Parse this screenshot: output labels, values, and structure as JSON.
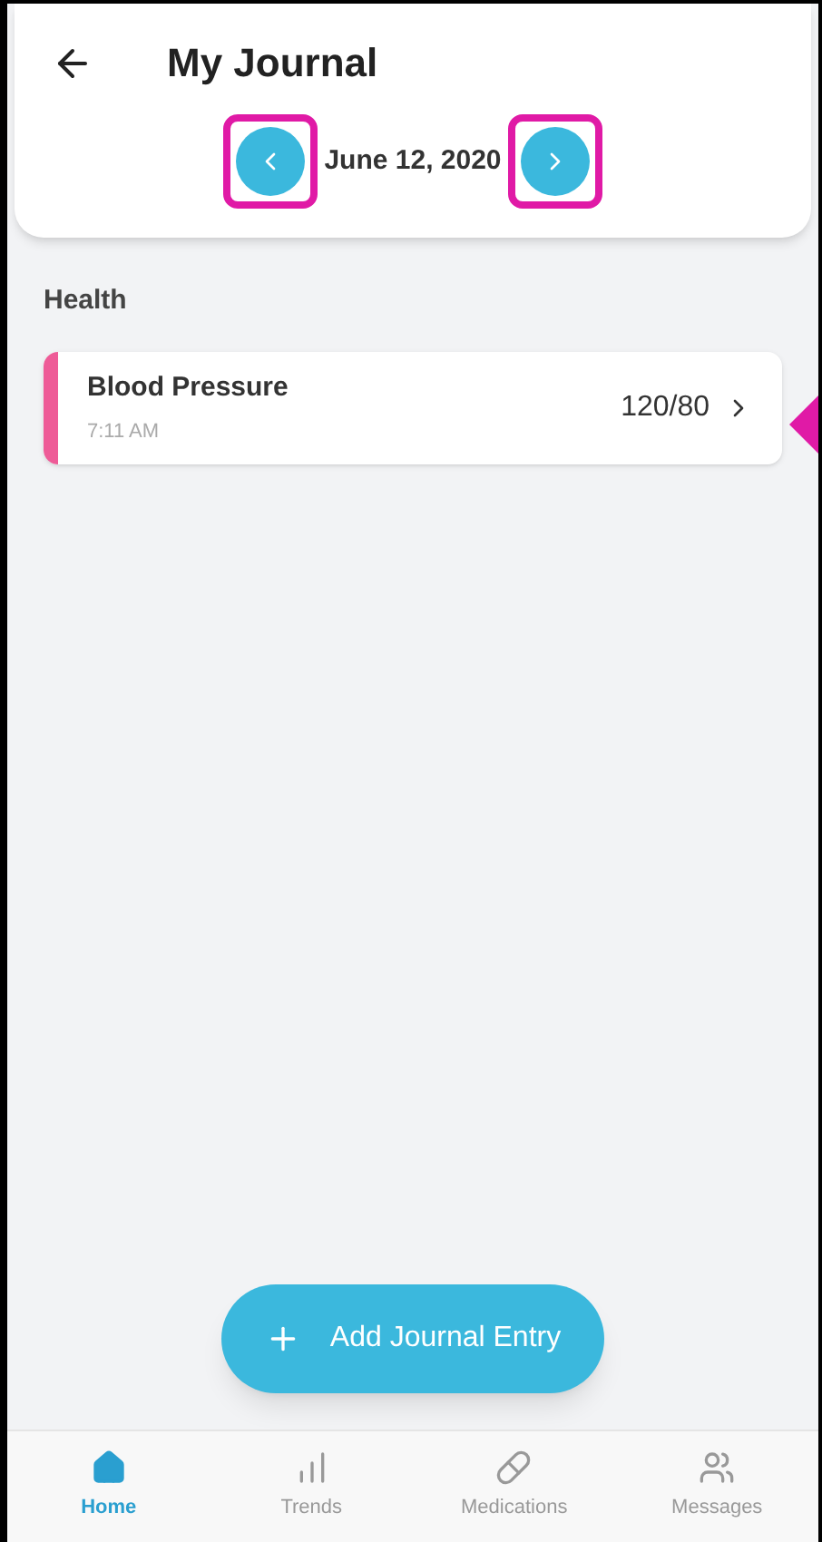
{
  "header": {
    "title": "My Journal",
    "date": "June 12, 2020"
  },
  "section": {
    "title": "Health"
  },
  "entries": [
    {
      "name": "Blood Pressure",
      "time": "7:11 AM",
      "reading": "120/80",
      "color": "#ee5b97"
    }
  ],
  "add_button": {
    "label": "Add Journal Entry"
  },
  "nav": [
    {
      "label": "Home",
      "selected": true
    },
    {
      "label": "Trends",
      "selected": false
    },
    {
      "label": "Medications",
      "selected": false
    },
    {
      "label": "Messages",
      "selected": false
    }
  ]
}
